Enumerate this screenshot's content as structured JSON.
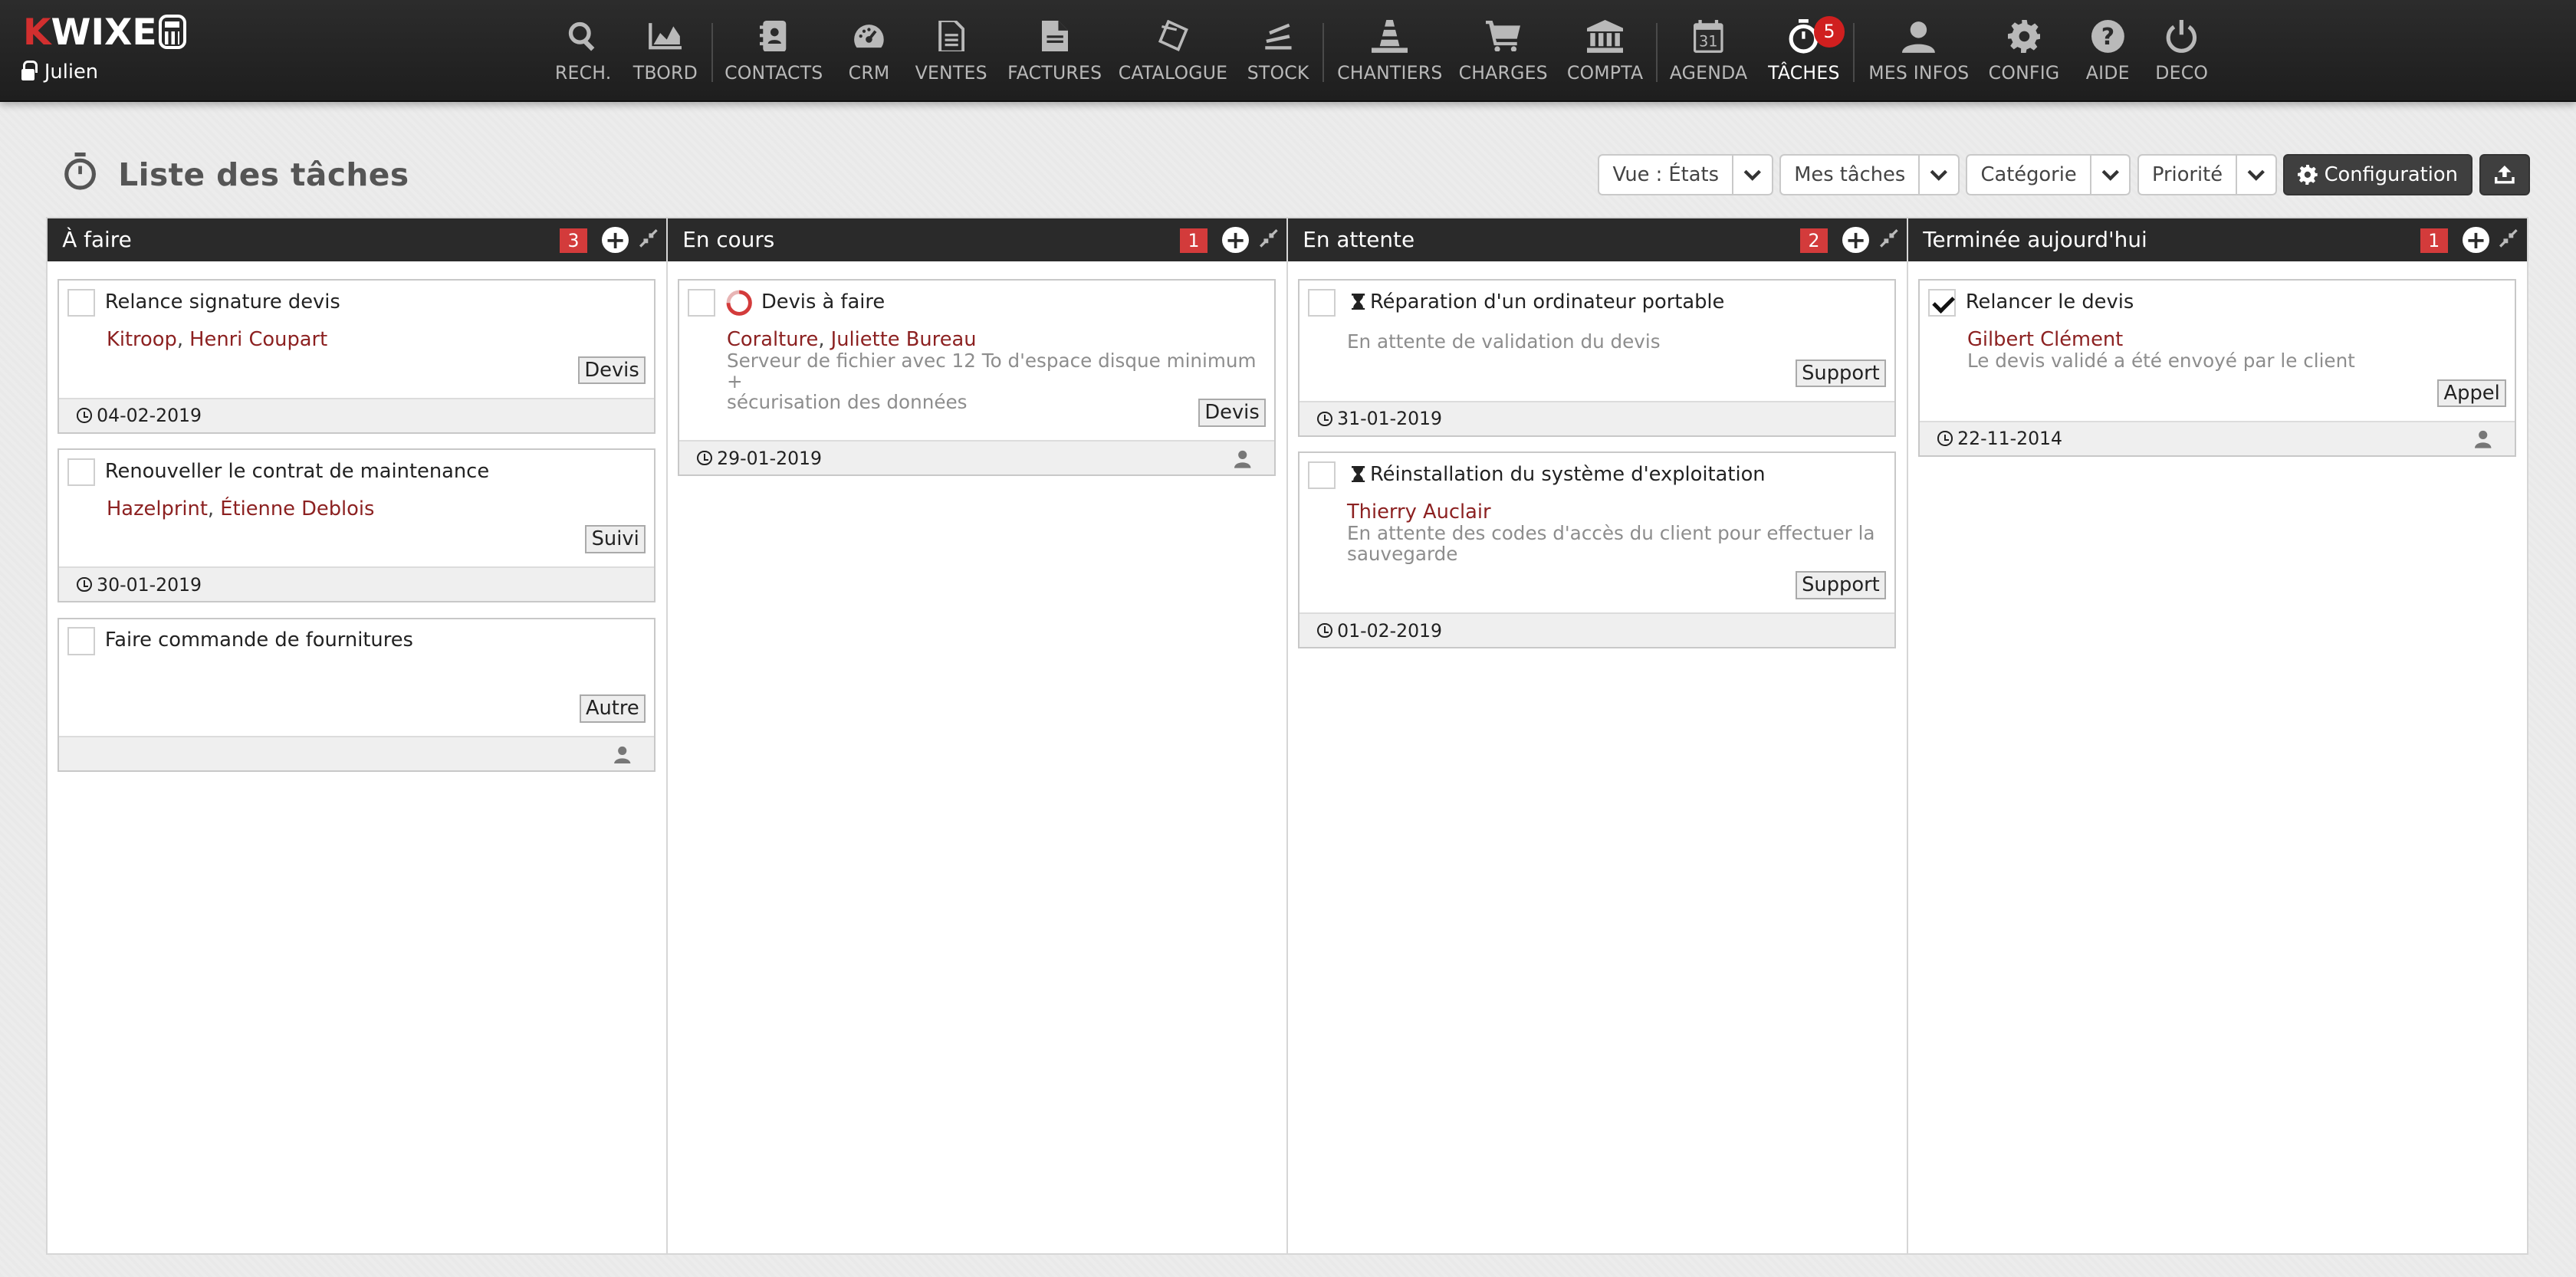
{
  "app": {
    "logo": "KWIXE",
    "user": "Julien"
  },
  "nav": [
    {
      "id": "search",
      "label": "RECH.",
      "icon": "search-icon"
    },
    {
      "id": "tbord",
      "label": "TBORD",
      "icon": "chart-area-icon"
    },
    {
      "id": "contacts",
      "label": "CONTACTS",
      "icon": "address-book-icon"
    },
    {
      "id": "crm",
      "label": "CRM",
      "icon": "dashboard-icon"
    },
    {
      "id": "ventes",
      "label": "VENTES",
      "icon": "document-icon"
    },
    {
      "id": "factures",
      "label": "FACTURES",
      "icon": "file-icon"
    },
    {
      "id": "catalogue",
      "label": "CATALOGUE",
      "icon": "tags-icon"
    },
    {
      "id": "stock",
      "label": "STOCK",
      "icon": "stack-icon"
    },
    {
      "id": "chantiers",
      "label": "CHANTIERS",
      "icon": "cone-icon"
    },
    {
      "id": "charges",
      "label": "CHARGES",
      "icon": "cart-icon"
    },
    {
      "id": "compta",
      "label": "COMPTA",
      "icon": "bank-icon"
    },
    {
      "id": "agenda",
      "label": "AGENDA",
      "icon": "calendar-icon",
      "day": "31"
    },
    {
      "id": "taches",
      "label": "TÂCHES",
      "icon": "stopwatch-icon",
      "badge": "5",
      "active": true
    },
    {
      "id": "mesinfos",
      "label": "MES INFOS",
      "icon": "user-icon"
    },
    {
      "id": "config",
      "label": "CONFIG",
      "icon": "gear-icon"
    },
    {
      "id": "aide",
      "label": "AIDE",
      "icon": "help-icon"
    },
    {
      "id": "deco",
      "label": "DECO",
      "icon": "power-icon"
    }
  ],
  "page": {
    "title": "Liste des tâches"
  },
  "toolbar": {
    "view": "Vue : États",
    "mine": "Mes tâches",
    "category": "Catégorie",
    "priority": "Priorité",
    "config": "Configuration"
  },
  "columns": [
    {
      "title": "À faire",
      "count": "3",
      "cards": [
        {
          "title": "Relance signature devis",
          "links": [
            "Kitroop",
            "Henri Coupart"
          ],
          "tag": "Devis",
          "date": "04-02-2019"
        },
        {
          "title": "Renouveller le contrat de maintenance",
          "links": [
            "Hazelprint",
            "Étienne Deblois"
          ],
          "tag": "Suivi",
          "date": "30-01-2019"
        },
        {
          "title": "Faire commande de fournitures",
          "tag": "Autre",
          "date": ""
        }
      ]
    },
    {
      "title": "En cours",
      "count": "1",
      "cards": [
        {
          "title": "Devis à faire",
          "links": [
            "Coralture",
            "Juliette Bureau"
          ],
          "desc": [
            "Serveur de fichier avec 12 To d'espace disque minimum +",
            "sécurisation des données"
          ],
          "tag": "Devis",
          "date": "29-01-2019"
        }
      ]
    },
    {
      "title": "En attente",
      "count": "2",
      "cards": [
        {
          "title": "Réparation d'un ordinateur portable",
          "desc": [
            "En attente de validation du devis"
          ],
          "tag": "Support",
          "date": "31-01-2019"
        },
        {
          "title": "Réinstallation du système d'exploitation",
          "links": [
            "Thierry Auclair"
          ],
          "desc": [
            "En attente des codes d'accès du client pour effectuer la",
            "sauvegarde"
          ],
          "tag": "Support",
          "date": "01-02-2019"
        }
      ]
    },
    {
      "title": "Terminée aujourd'hui",
      "count": "1",
      "cards": [
        {
          "title": "Relancer le devis",
          "links": [
            "Gilbert Clément"
          ],
          "desc": [
            "Le devis validé a été envoyé par le client"
          ],
          "tag": "Appel",
          "date": "22-11-2014",
          "checked": true
        }
      ]
    }
  ],
  "colors": {
    "accent": "#d33b3b",
    "link": "#8c2121",
    "topbar": "#262626"
  }
}
